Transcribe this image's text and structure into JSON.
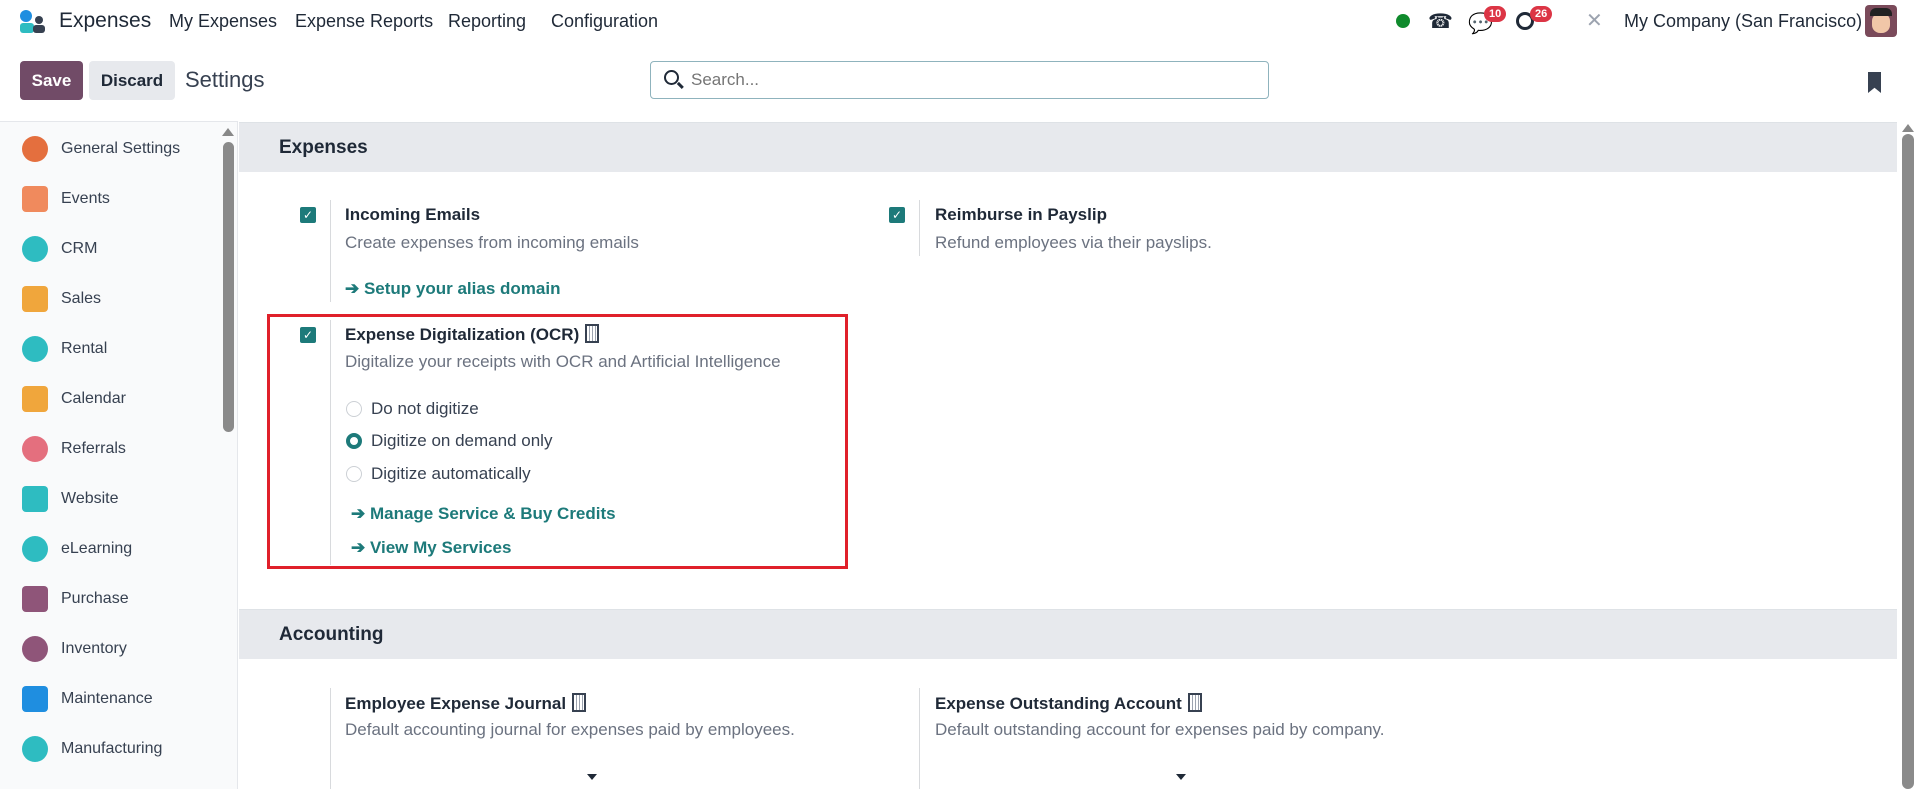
{
  "navbar": {
    "app_name": "Expenses",
    "menu": [
      "My Expenses",
      "Expense Reports",
      "Reporting",
      "Configuration"
    ],
    "messages_count": "10",
    "activities_count": "26",
    "company": "My Company (San Francisco)"
  },
  "control_panel": {
    "save_label": "Save",
    "discard_label": "Discard",
    "title": "Settings",
    "search_placeholder": "Search..."
  },
  "sidebar": {
    "items": [
      {
        "label": "General Settings",
        "color": "#e46f3e"
      },
      {
        "label": "Events",
        "color": "#f08a5d"
      },
      {
        "label": "CRM",
        "color": "#2ebcc1"
      },
      {
        "label": "Sales",
        "color": "#f0a63c"
      },
      {
        "label": "Rental",
        "color": "#2ebcc1"
      },
      {
        "label": "Calendar",
        "color": "#f0a63c"
      },
      {
        "label": "Referrals",
        "color": "#e46f7e"
      },
      {
        "label": "Website",
        "color": "#2ebcc1"
      },
      {
        "label": "eLearning",
        "color": "#2ebcc1"
      },
      {
        "label": "Purchase",
        "color": "#8f5579"
      },
      {
        "label": "Inventory",
        "color": "#8f5579"
      },
      {
        "label": "Maintenance",
        "color": "#1f8ee0"
      },
      {
        "label": "Manufacturing",
        "color": "#2ebcc1"
      }
    ]
  },
  "sections": {
    "expenses": {
      "title": "Expenses",
      "incoming_emails": {
        "title": "Incoming Emails",
        "desc": "Create expenses from incoming emails",
        "link": "Setup your alias domain",
        "checked": true
      },
      "reimburse": {
        "title": "Reimburse in Payslip",
        "desc": "Refund employees via their payslips.",
        "checked": true
      },
      "ocr": {
        "title": "Expense Digitalization (OCR)",
        "desc": "Digitalize your receipts with OCR and Artificial Intelligence",
        "checked": true,
        "options": [
          "Do not digitize",
          "Digitize on demand only",
          "Digitize automatically"
        ],
        "selected": "Digitize on demand only",
        "link1": "Manage Service & Buy Credits",
        "link2": "View My Services"
      }
    },
    "accounting": {
      "title": "Accounting",
      "journal": {
        "title": "Employee Expense Journal",
        "desc": "Default accounting journal for expenses paid by employees."
      },
      "account": {
        "title": "Expense Outstanding Account",
        "desc": "Default outstanding account for expenses paid by company."
      }
    }
  },
  "colors": {
    "primary": "#714b67",
    "accent": "#1d7a7a",
    "highlight": "#e0202a"
  }
}
